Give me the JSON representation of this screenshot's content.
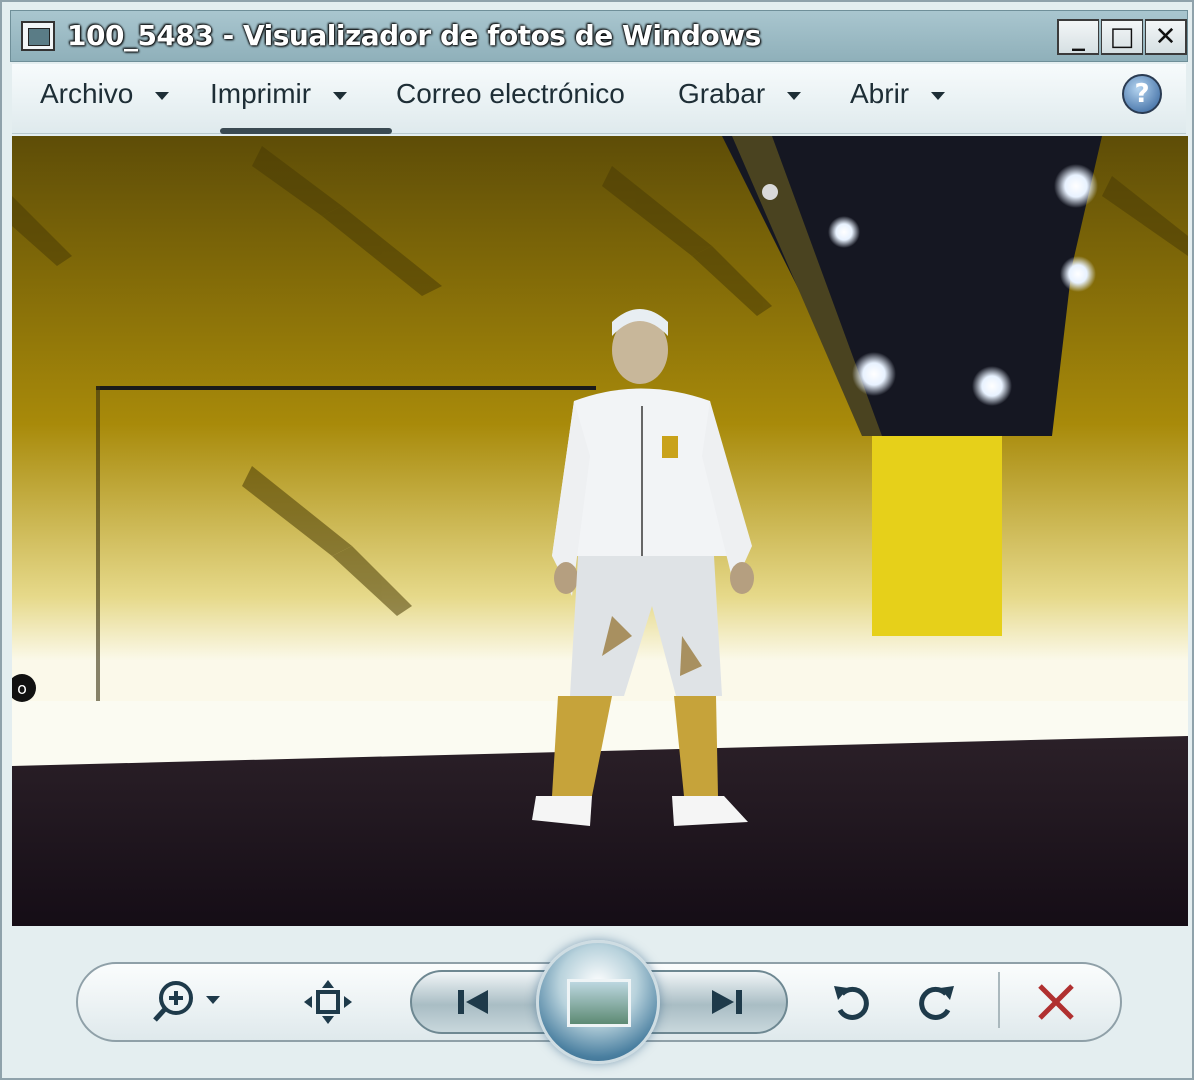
{
  "window": {
    "title": "100_5483 - Visualizador de fotos de Windows",
    "min_glyph": "_",
    "max_glyph": "□",
    "close_glyph": "✕"
  },
  "menu": {
    "items": [
      {
        "label": "Archivo",
        "has_dropdown": true
      },
      {
        "label": "Imprimir",
        "has_dropdown": true
      },
      {
        "label": "Correo electrónico",
        "has_dropdown": false
      },
      {
        "label": "Grabar",
        "has_dropdown": true
      },
      {
        "label": "Abrir",
        "has_dropdown": true
      }
    ],
    "help_glyph": "?"
  },
  "photo": {
    "description_icon": "photo-image",
    "side_glyph": "o"
  },
  "toolbar": {
    "zoom_icon": "zoom-icon",
    "fit_icon": "actual-size-icon",
    "prev_icon": "previous-icon",
    "slideshow_icon": "slideshow-icon",
    "next_icon": "next-icon",
    "rotate_ccw_icon": "rotate-counterclockwise-icon",
    "rotate_cw_icon": "rotate-clockwise-icon",
    "delete_icon": "delete-icon"
  },
  "colors": {
    "delete": "#b03030",
    "accent": "#2e5e98"
  }
}
